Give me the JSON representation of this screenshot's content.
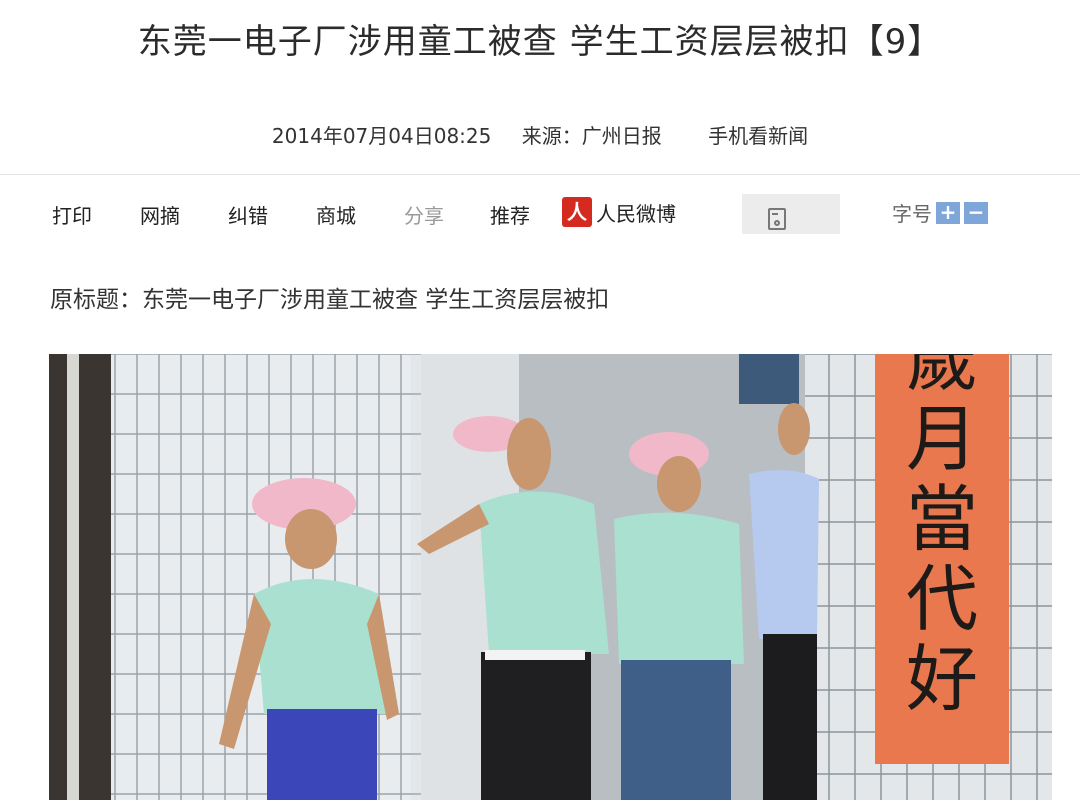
{
  "article": {
    "headline": "东莞一电子厂涉用童工被查 学生工资层层被扣【9】",
    "date": "2014年07月04日08:25",
    "source_label": "来源：",
    "source_name": "广州日报",
    "mobile_link": "手机看新闻",
    "original_title": "原标题：东莞一电子厂涉用童工被查 学生工资层层被扣"
  },
  "toolbar": {
    "print": "打印",
    "excerpt": "网摘",
    "correct": "纠错",
    "mall": "商城",
    "share": "分享",
    "recommend": "推荐",
    "weibo_logo_char": "人",
    "weibo": "人民微博",
    "font_size_label": "字号",
    "font_plus": "+",
    "font_minus": "−"
  },
  "photo": {
    "banner_chars": [
      "歲",
      "月",
      "當",
      "代",
      "好"
    ]
  },
  "colors": {
    "banner": "#e9784f",
    "font_button": "#7fa6d8",
    "weibo_red": "#d42a1f"
  }
}
